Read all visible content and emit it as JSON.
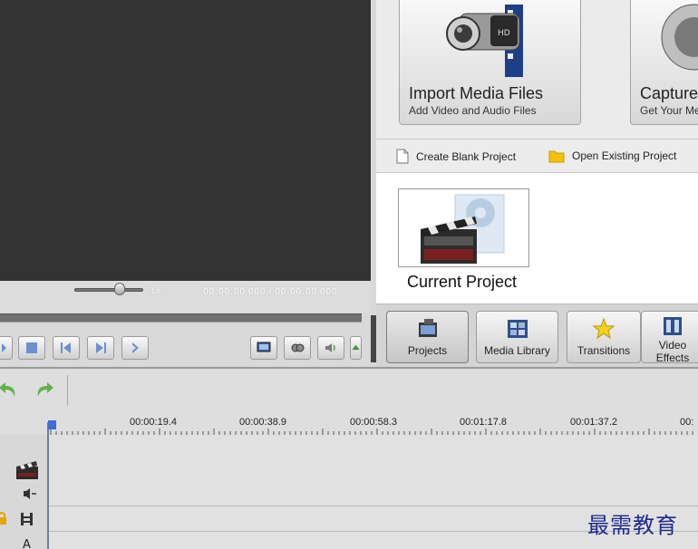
{
  "preview": {
    "speed_label": "1x",
    "time_readout": "00:00:00.000 / 00:00:00.000"
  },
  "import_card": {
    "title": "Import Media Files",
    "subtitle": "Add Video and Audio Files"
  },
  "capture_card": {
    "title": "Capture",
    "subtitle": "Get Your Me"
  },
  "project_actions": {
    "create_blank": "Create Blank Project",
    "open_existing": "Open Existing Project"
  },
  "current_project": {
    "label": "Current Project"
  },
  "tabs": [
    {
      "label": "Projects",
      "icon": "projects-icon"
    },
    {
      "label": "Media Library",
      "icon": "media-library-icon"
    },
    {
      "label": "Transitions",
      "icon": "star-icon"
    },
    {
      "label": "Video\nEffects",
      "icon": "video-effects-icon"
    }
  ],
  "timeline": {
    "ticks": [
      "00:00:19.4",
      "00:00:38.9",
      "00:00:58.3",
      "00:01:17.8",
      "00:01:37.2",
      "00:"
    ]
  },
  "watermark": "最需教育",
  "colors": {
    "preview_bg": "#333333",
    "accent_blue": "#3d6fd4",
    "watermark": "#1f2a8c"
  }
}
